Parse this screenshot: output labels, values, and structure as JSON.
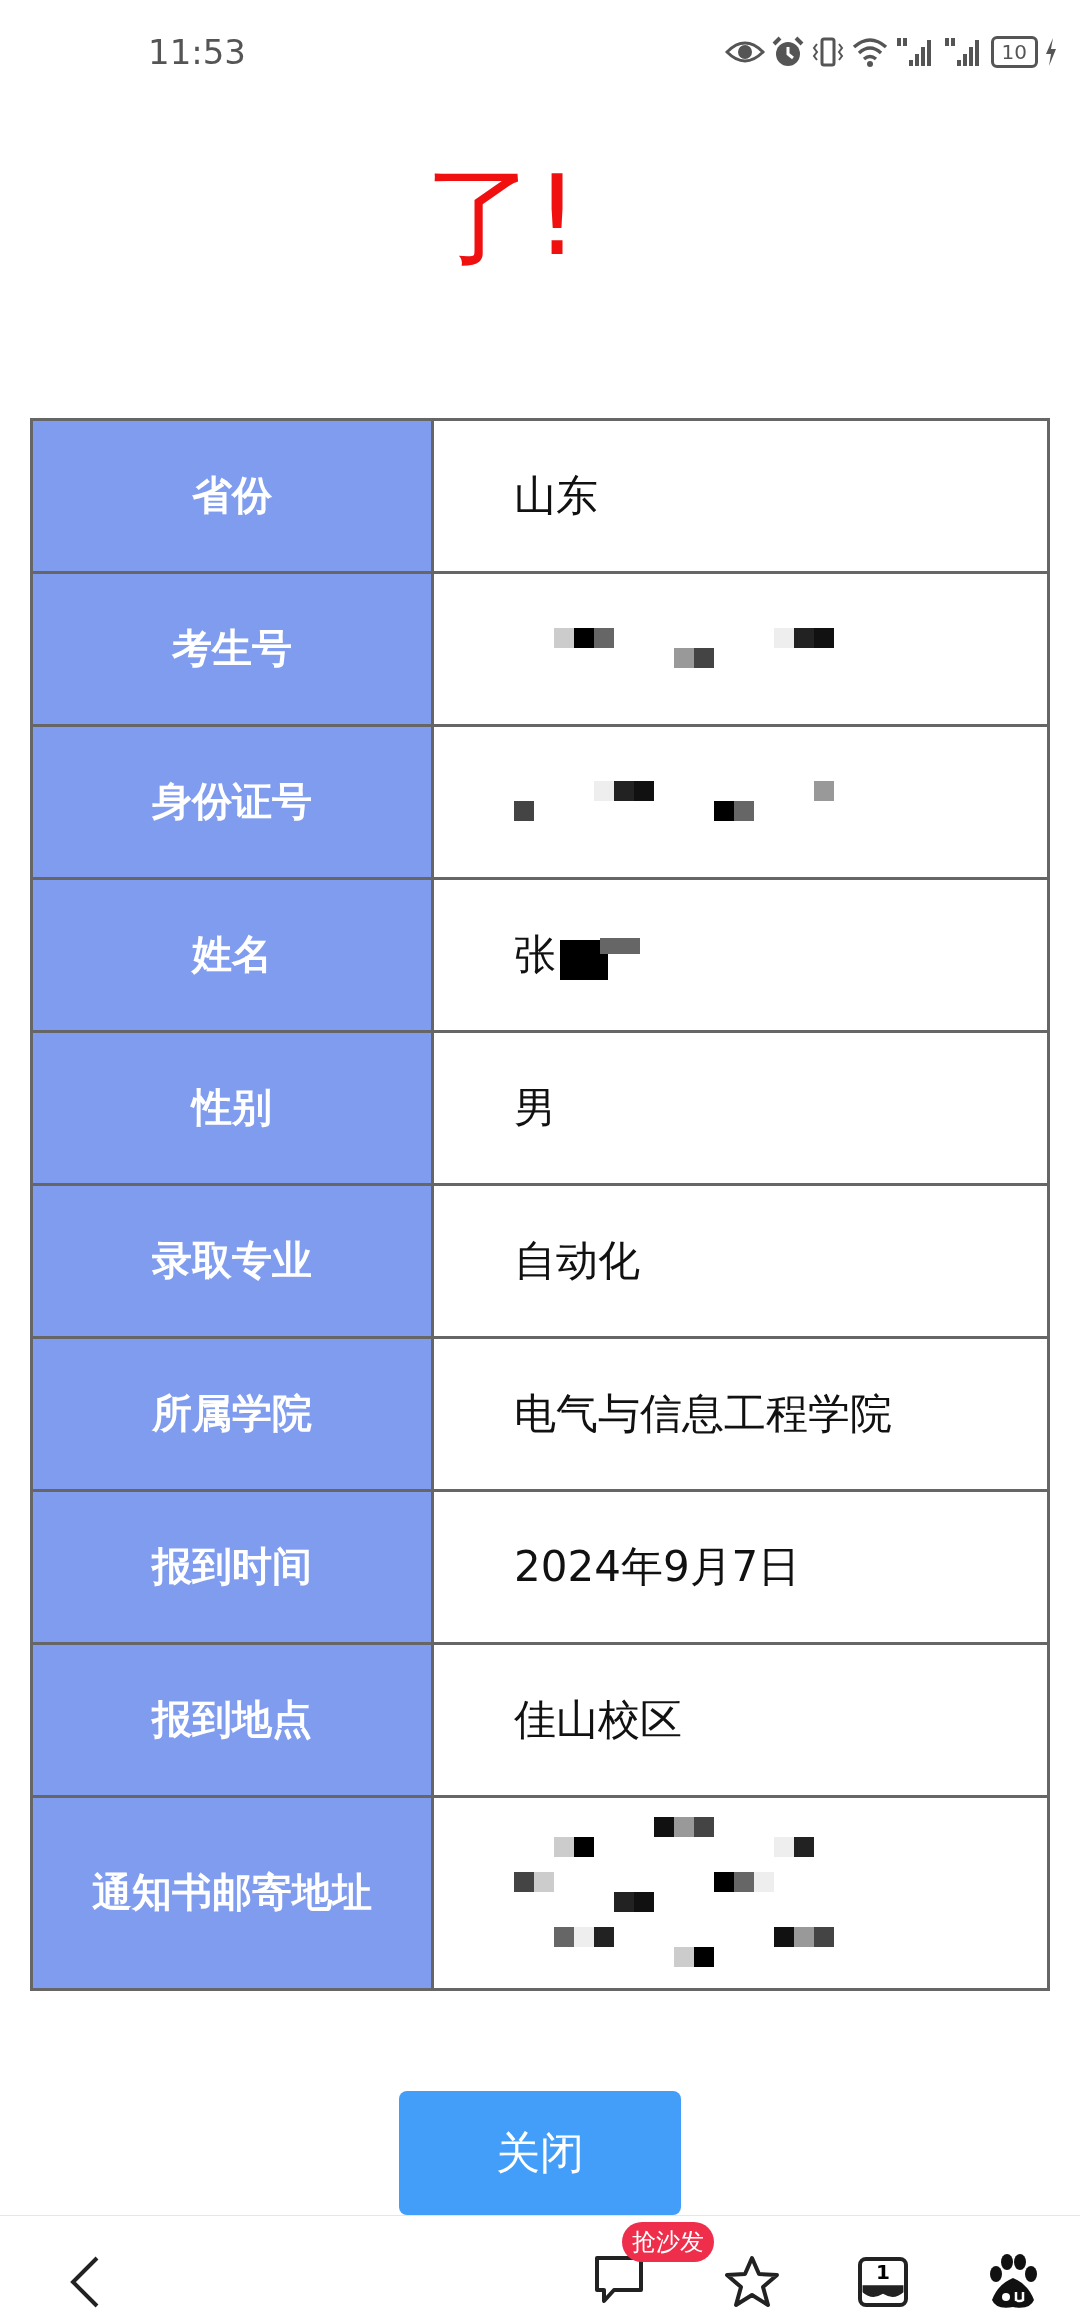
{
  "status_bar": {
    "time": "11:53",
    "battery": "10"
  },
  "heading": "了!",
  "table": {
    "rows": [
      {
        "label": "省份",
        "kind": "text",
        "value": "山东"
      },
      {
        "label": "考生号",
        "kind": "redacted"
      },
      {
        "label": "身份证号",
        "kind": "redacted"
      },
      {
        "label": "姓名",
        "kind": "partly_redacted",
        "value": "张"
      },
      {
        "label": "性别",
        "kind": "text",
        "value": "男"
      },
      {
        "label": "录取专业",
        "kind": "text",
        "value": "自动化"
      },
      {
        "label": "所属学院",
        "kind": "text",
        "value": "电气与信息工程学院"
      },
      {
        "label": "报到时间",
        "kind": "text",
        "value": "2024年9月7日"
      },
      {
        "label": "报到地点",
        "kind": "text",
        "value": "佳山校区"
      },
      {
        "label": "通知书邮寄地址",
        "kind": "redacted_multiline"
      }
    ]
  },
  "close_button": "关闭",
  "bottom_bar": {
    "comment_badge": "抢沙发",
    "tab_count": "1"
  }
}
